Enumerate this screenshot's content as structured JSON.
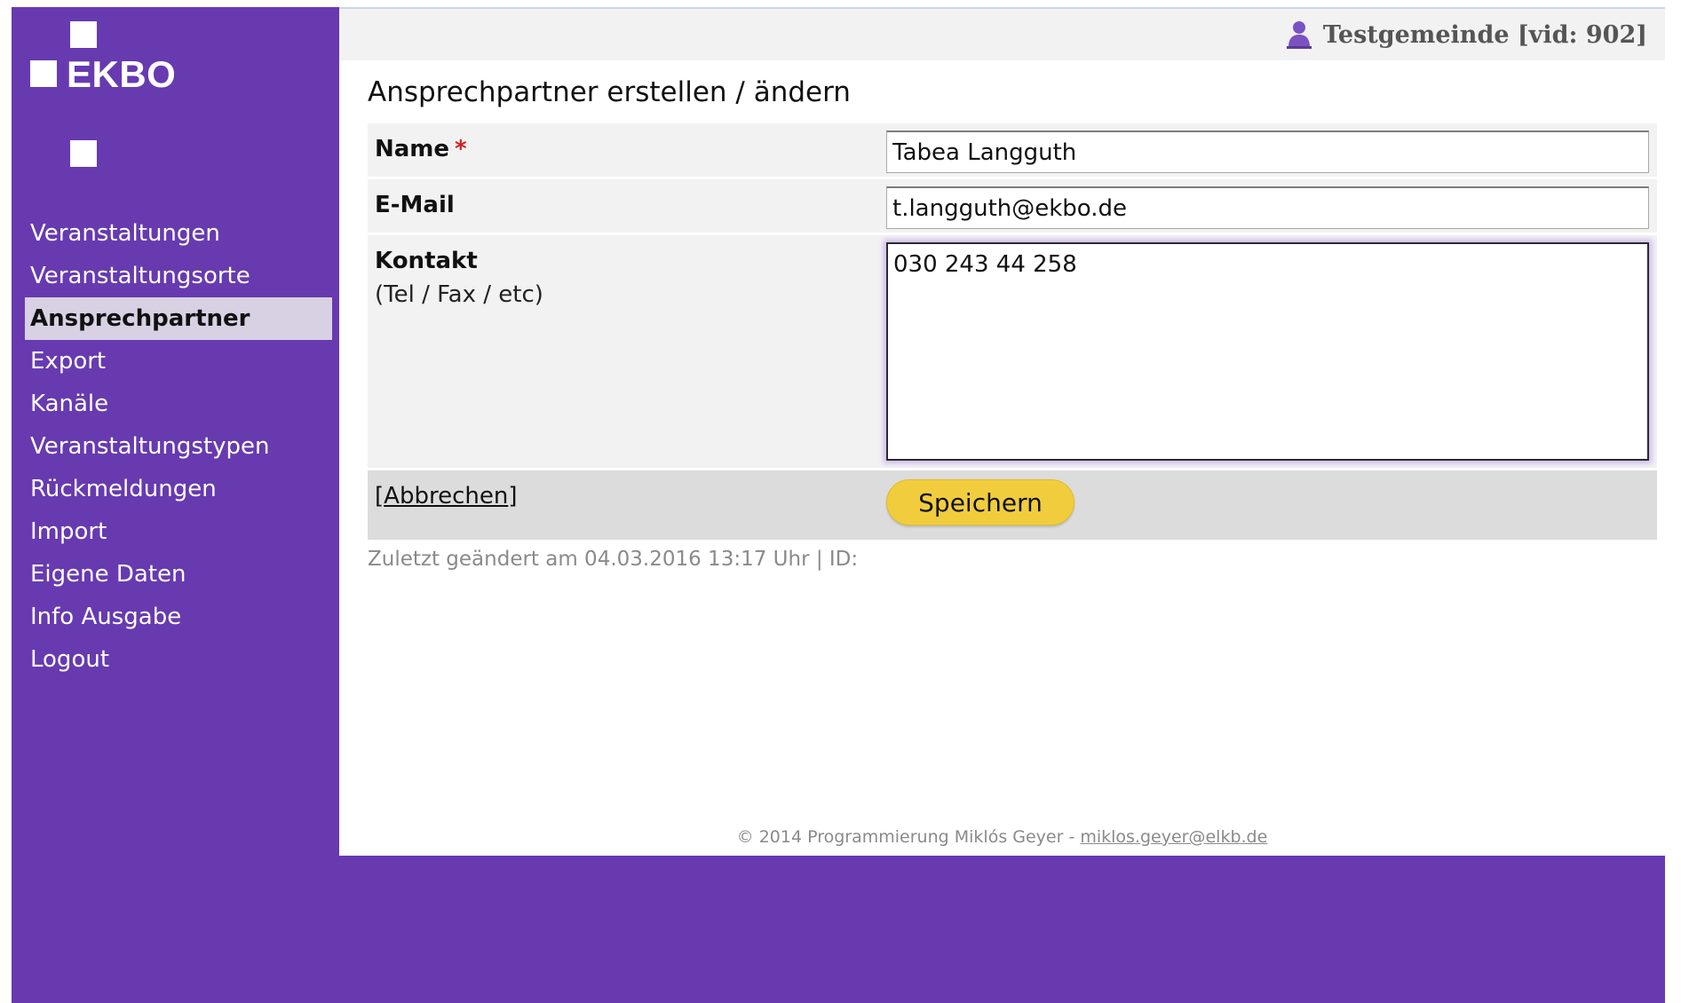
{
  "brand": {
    "name": "EKBO"
  },
  "header": {
    "user_icon": "user-icon",
    "user_text": "Testgemeinde [vid: 902]"
  },
  "sidebar": {
    "items": [
      {
        "label": "Veranstaltungen",
        "active": false
      },
      {
        "label": "Veranstaltungsorte",
        "active": false
      },
      {
        "label": "Ansprechpartner",
        "active": true
      },
      {
        "label": "Export",
        "active": false
      },
      {
        "label": "Kanäle",
        "active": false
      },
      {
        "label": "Veranstaltungstypen",
        "active": false
      },
      {
        "label": "Rückmeldungen",
        "active": false
      },
      {
        "label": "Import",
        "active": false
      },
      {
        "label": "Eigene Daten",
        "active": false
      },
      {
        "label": "Info Ausgabe",
        "active": false
      },
      {
        "label": "Logout",
        "active": false
      }
    ]
  },
  "page": {
    "title": "Ansprechpartner erstellen / ändern"
  },
  "form": {
    "name": {
      "label": "Name",
      "required_marker": "*",
      "value": "Tabea Langguth"
    },
    "email": {
      "label": "E-Mail",
      "value": "t.langguth@ekbo.de"
    },
    "contact": {
      "label": "Kontakt",
      "sublabel": "(Tel / Fax / etc)",
      "value": "030 243 44 258"
    },
    "actions": {
      "cancel_open": "[",
      "cancel_label": "Abbrechen",
      "cancel_close": "]",
      "save_label": "Speichern"
    }
  },
  "meta": {
    "last_changed": "Zuletzt geändert am 04.03.2016 13:17 Uhr | ID:"
  },
  "footer": {
    "copyright": "© 2014 Programmierung Miklós Geyer - ",
    "email": "miklos.geyer@elkb.de"
  },
  "colors": {
    "brand_purple": "#673ab0",
    "active_nav_bg": "#d8d1e4",
    "save_button": "#f1cd3e",
    "required_marker": "#d42020"
  }
}
